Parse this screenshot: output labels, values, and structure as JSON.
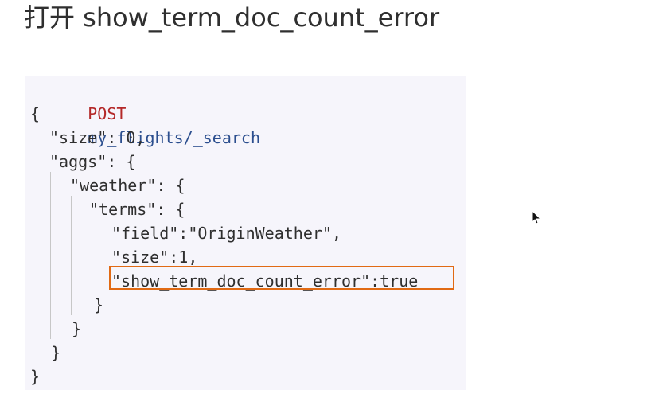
{
  "page": {
    "title": "打开 show_term_doc_count_error"
  },
  "code": {
    "method": "POST",
    "path": "my_flights/_search",
    "lines": [
      "{",
      "\"size\": 0,",
      "\"aggs\": {",
      "\"weather\": {",
      "\"terms\": {",
      "\"field\":\"OriginWeather\",",
      "\"size\":1,",
      "\"show_term_doc_count_error\":true",
      "}",
      "}",
      "}",
      "}"
    ]
  },
  "icons": {
    "cursor": "mouse-pointer-icon"
  },
  "colors": {
    "title": "#2f2f2f",
    "panel_bg": "#f6f5fb",
    "method": "#b42828",
    "json_key": "#2b4e8e",
    "literal_true": "#2a45d1",
    "highlight": "#e16a14"
  }
}
